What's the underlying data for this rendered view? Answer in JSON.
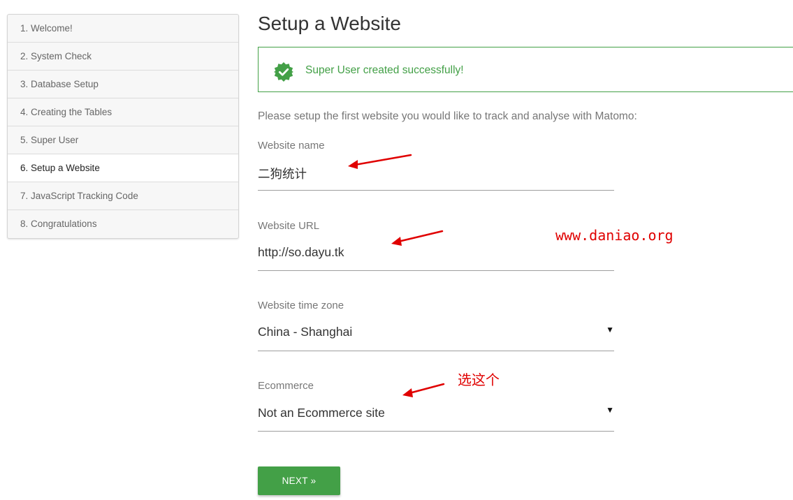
{
  "sidebar": {
    "steps": [
      {
        "label": "1. Welcome!"
      },
      {
        "label": "2. System Check"
      },
      {
        "label": "3. Database Setup"
      },
      {
        "label": "4. Creating the Tables"
      },
      {
        "label": "5. Super User"
      },
      {
        "label": "6. Setup a Website"
      },
      {
        "label": "7. JavaScript Tracking Code"
      },
      {
        "label": "8. Congratulations"
      }
    ],
    "active_step": "6. Setup a Website"
  },
  "page": {
    "title": "Setup a Website",
    "alert_message": "Super User created successfully!",
    "intro": "Please setup the first website you would like to track and analyse with Matomo:"
  },
  "form": {
    "website_name": {
      "label": "Website name",
      "value": "二狗统计"
    },
    "website_url": {
      "label": "Website URL",
      "value": "http://so.dayu.tk"
    },
    "time_zone": {
      "label": "Website time zone",
      "value": "China - Shanghai"
    },
    "ecommerce": {
      "label": "Ecommerce",
      "value": "Not an Ecommerce site"
    }
  },
  "actions": {
    "next_label": "NEXT »"
  },
  "annotations": {
    "watermark": "www.daniao.org",
    "note": "选这个"
  },
  "colors": {
    "accent": "#43a047",
    "annotation": "#e00000"
  },
  "icons": {
    "alert": "check-badge-icon",
    "dropdown": "caret-down-icon"
  }
}
